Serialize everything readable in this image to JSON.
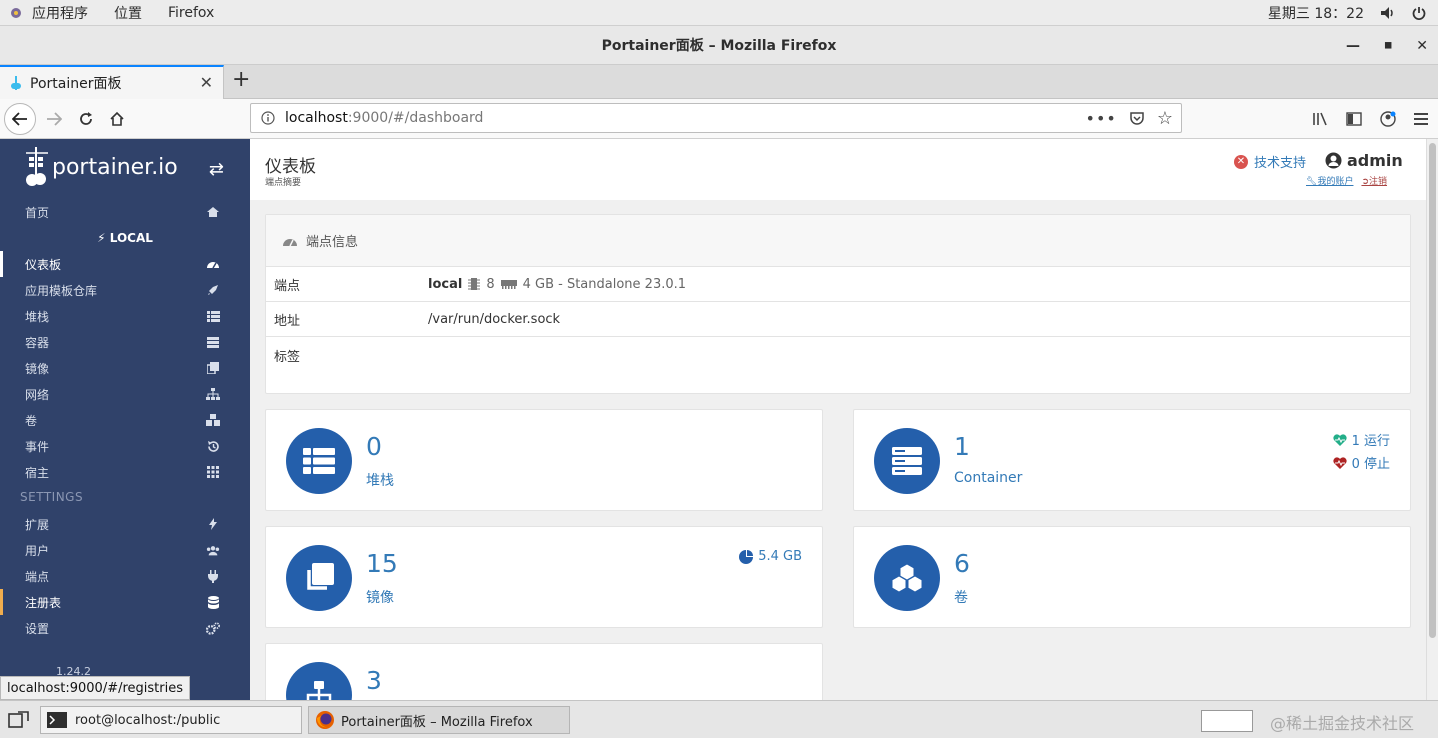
{
  "system_bar": {
    "menu": [
      "应用程序",
      "位置",
      "Firefox"
    ],
    "clock": "星期三 18：22"
  },
  "window": {
    "title": "Portainer面板 – Mozilla Firefox"
  },
  "browser": {
    "tab_title": "Portainer面板",
    "url_host": "localhost",
    "url_rest": ":9000/#/dashboard",
    "status_url": "localhost:9000/#/registries"
  },
  "sidebar": {
    "brand": "portainer.io",
    "home": "首页",
    "endpoint_label": "LOCAL",
    "items": [
      {
        "label": "仪表板",
        "icon": "tachometer-icon"
      },
      {
        "label": "应用模板仓库",
        "icon": "rocket-icon"
      },
      {
        "label": "堆栈",
        "icon": "th-list-icon"
      },
      {
        "label": "容器",
        "icon": "server-icon"
      },
      {
        "label": "镜像",
        "icon": "clone-icon"
      },
      {
        "label": "网络",
        "icon": "sitemap-icon"
      },
      {
        "label": "卷",
        "icon": "cubes-icon"
      },
      {
        "label": "事件",
        "icon": "history-icon"
      },
      {
        "label": "宿主",
        "icon": "th-icon"
      }
    ],
    "settings_heading": "SETTINGS",
    "settings_items": [
      {
        "label": "扩展",
        "icon": "bolt-icon"
      },
      {
        "label": "用户",
        "icon": "users-icon"
      },
      {
        "label": "端点",
        "icon": "plug-icon"
      },
      {
        "label": "注册表",
        "icon": "database-icon"
      },
      {
        "label": "设置",
        "icon": "cogs-icon"
      }
    ],
    "footer_version": "1.24.2"
  },
  "header": {
    "title": "仪表板",
    "subtitle": "端点摘要",
    "support": "技术支持",
    "user": "admin",
    "my_account": "我的账户",
    "logout": "注销"
  },
  "endpoint_info": {
    "heading": "端点信息",
    "rows": {
      "endpoint_key": "端点",
      "endpoint_name": "local",
      "cpu": "8",
      "memory": "4 GB - Standalone 23.0.1",
      "address_key": "地址",
      "address": "/var/run/docker.sock",
      "tags_key": "标签"
    }
  },
  "widgets": {
    "stacks": {
      "value": "0",
      "label": "堆栈"
    },
    "containers": {
      "value": "1",
      "label": "Container",
      "running": "1 运行",
      "stopped": "0 停止"
    },
    "images": {
      "value": "15",
      "label": "镜像",
      "size": "5.4 GB"
    },
    "volumes": {
      "value": "6",
      "label": "卷"
    },
    "networks": {
      "value": "3"
    }
  },
  "taskbar": {
    "terminal": "root@localhost:/public",
    "firefox": "Portainer面板 – Mozilla Firefox",
    "watermark": "@稀土掘金技术社区"
  },
  "colors": {
    "sidebar_bg": "#30426a",
    "accent_blue": "#245fab",
    "link_blue": "#337ab7"
  }
}
